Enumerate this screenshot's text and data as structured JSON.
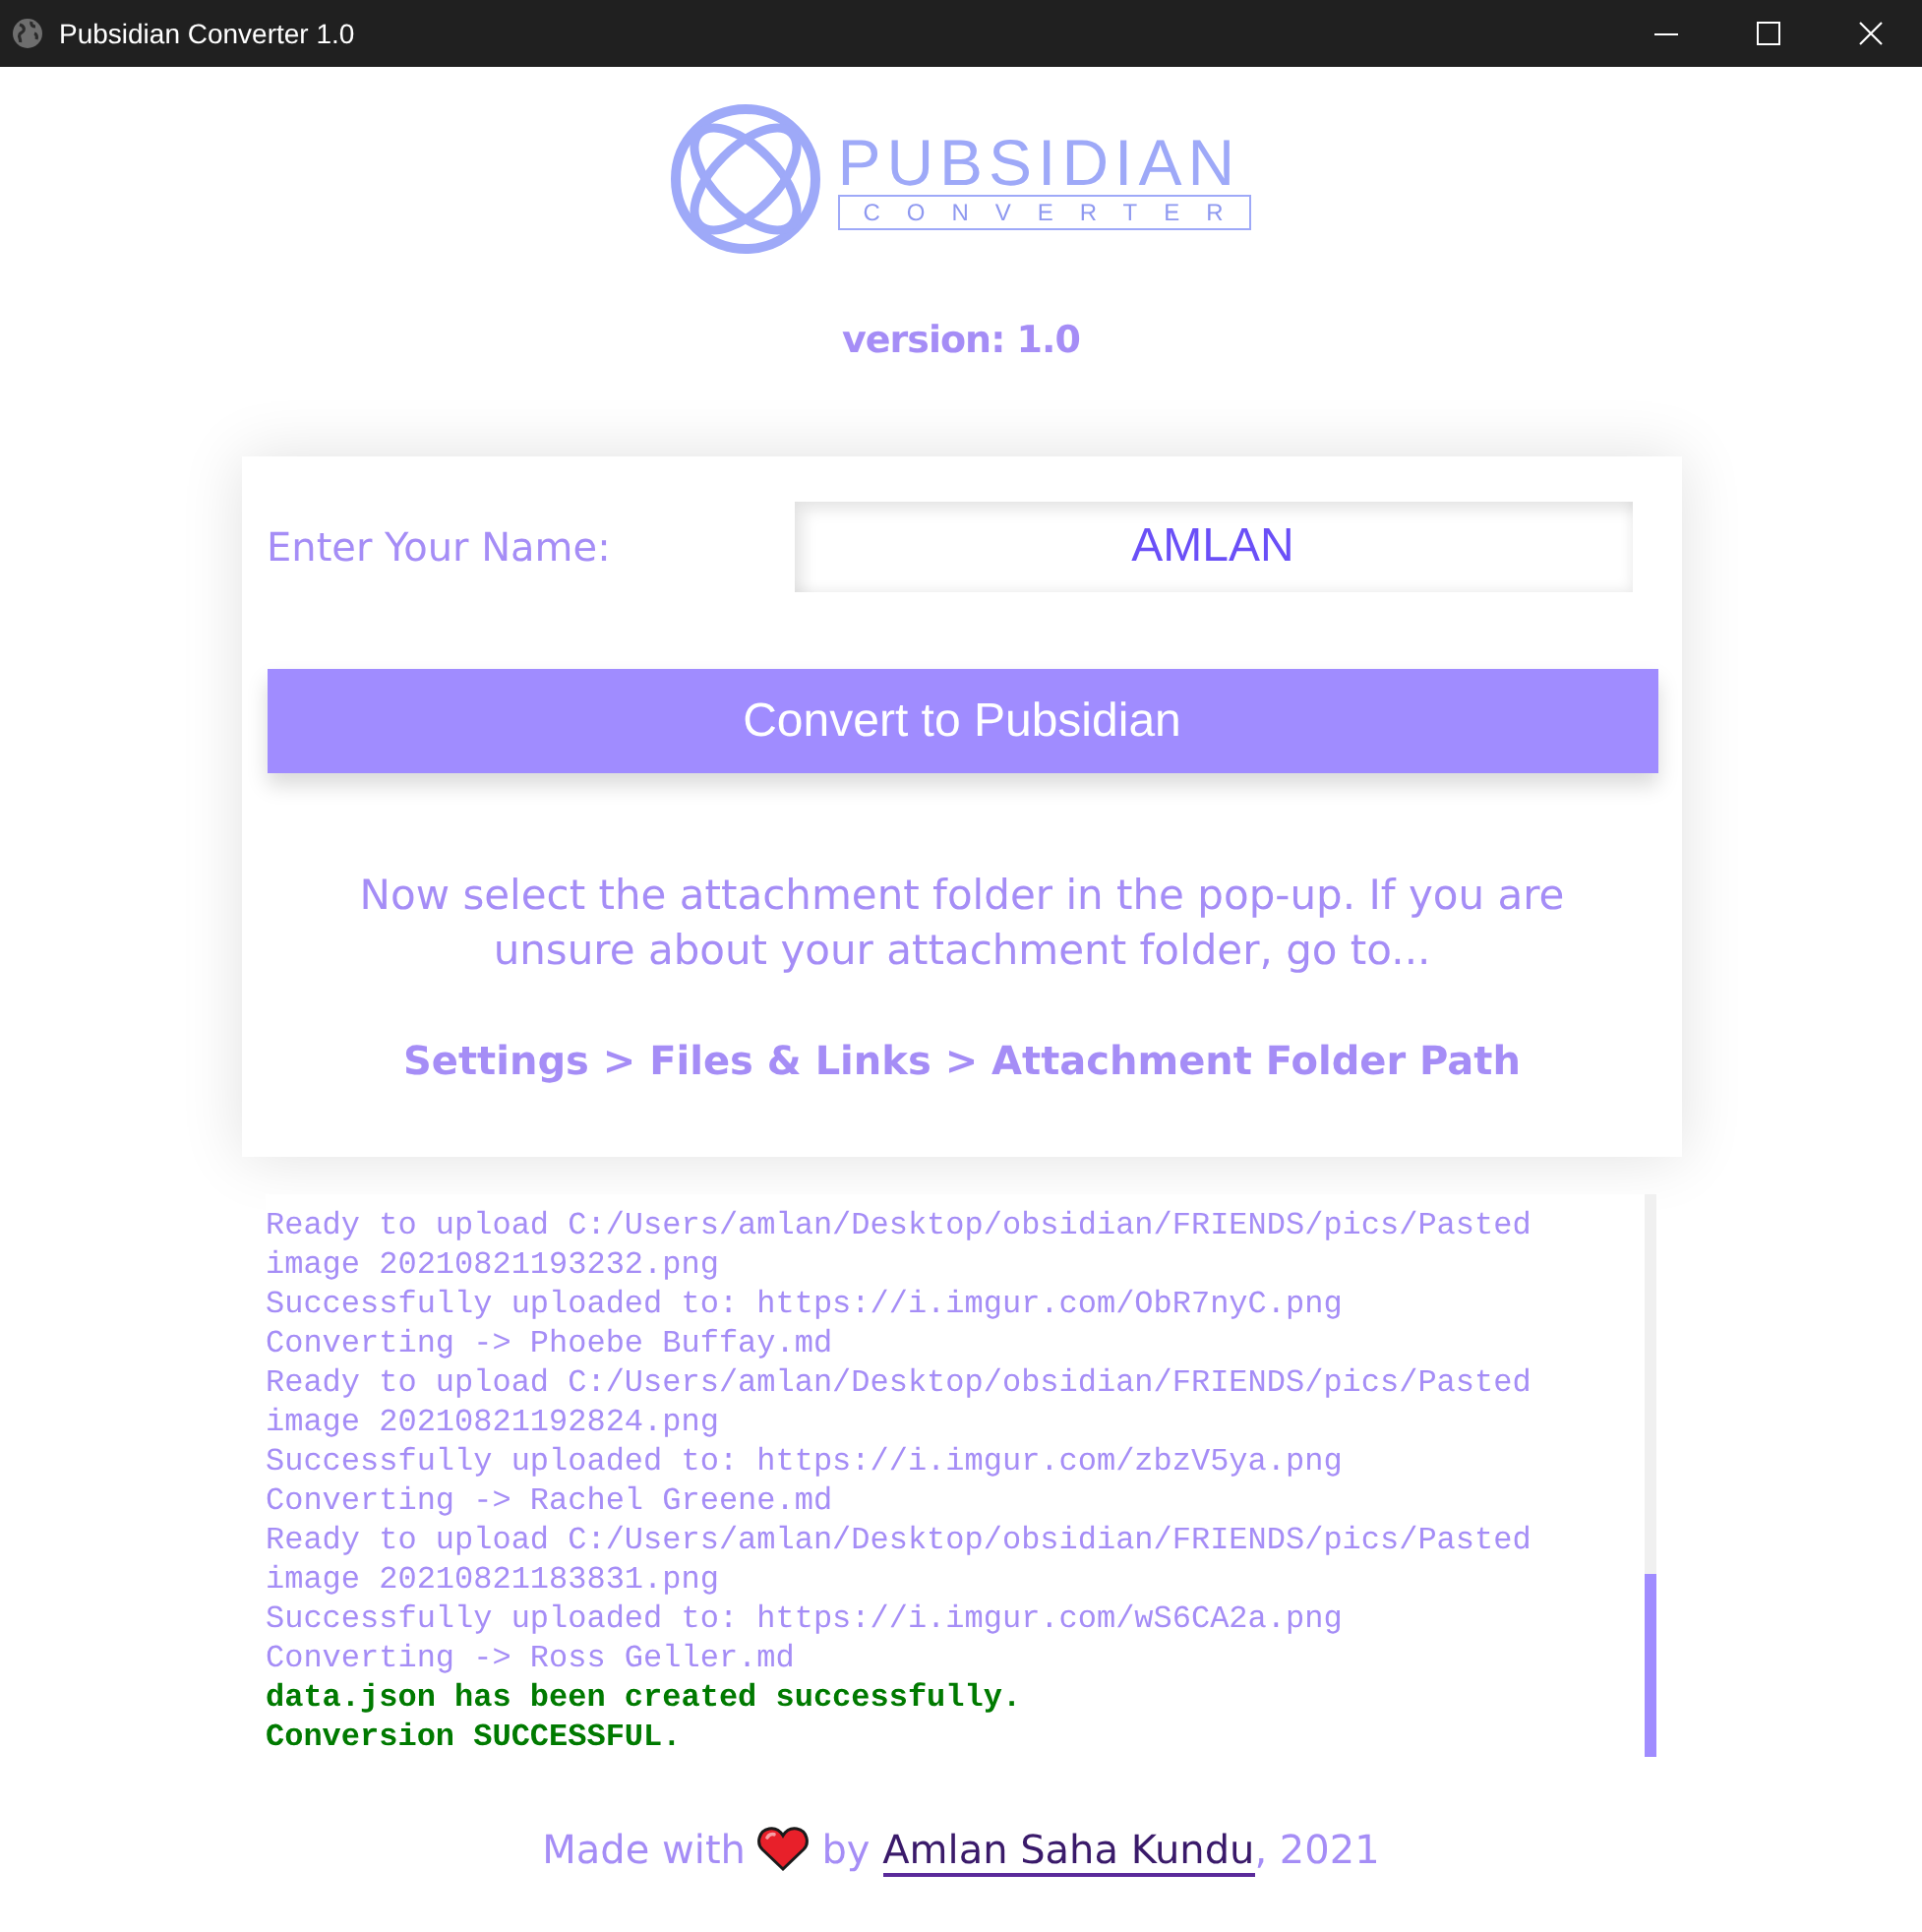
{
  "window": {
    "title": "Pubsidian Converter 1.0"
  },
  "logo": {
    "title": "PUBSIDIAN",
    "subtitle": "CONVERTER"
  },
  "version": "version: 1.0",
  "name_field": {
    "label": "Enter Your Name:",
    "value": "AMLAN"
  },
  "convert_button": "Convert to Pubsidian",
  "instructions": {
    "text": "Now select the attachment folder in the pop-up. If you are unsure about your attachment folder, go to...",
    "path": "Settings > Files & Links > Attachment Folder Path"
  },
  "log": [
    {
      "kind": "info",
      "text": "Ready to upload C:/Users/amlan/Desktop/obsidian/FRIENDS/pics/Pasted image 20210821193232.png"
    },
    {
      "kind": "info",
      "text": "Successfully uploaded to: https://i.imgur.com/ObR7nyC.png"
    },
    {
      "kind": "info",
      "text": "Converting -> Phoebe Buffay.md"
    },
    {
      "kind": "info",
      "text": "Ready to upload C:/Users/amlan/Desktop/obsidian/FRIENDS/pics/Pasted image 20210821192824.png"
    },
    {
      "kind": "info",
      "text": "Successfully uploaded to: https://i.imgur.com/zbzV5ya.png"
    },
    {
      "kind": "info",
      "text": "Converting -> Rachel Greene.md"
    },
    {
      "kind": "info",
      "text": "Ready to upload C:/Users/amlan/Desktop/obsidian/FRIENDS/pics/Pasted image 20210821183831.png"
    },
    {
      "kind": "info",
      "text": "Successfully uploaded to: https://i.imgur.com/wS6CA2a.png"
    },
    {
      "kind": "info",
      "text": "Converting -> Ross Geller.md"
    },
    {
      "kind": "success",
      "text": "data.json has been created successfully."
    },
    {
      "kind": "success",
      "text": "Conversion SUCCESSFUL."
    }
  ],
  "footer": {
    "prefix": "Made with",
    "middle": "by",
    "link": "Amlan Saha Kundu",
    "suffix": ", 2021"
  }
}
